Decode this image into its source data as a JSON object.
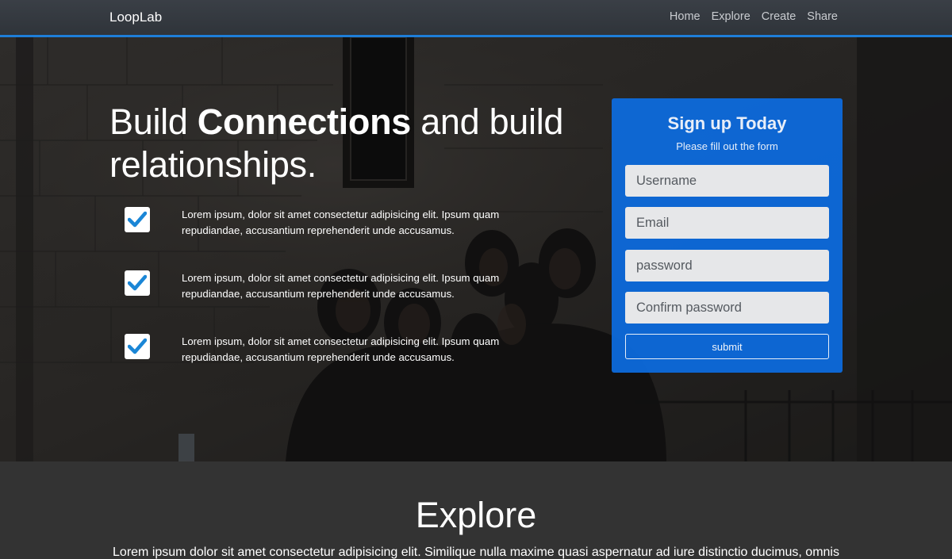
{
  "nav": {
    "brand": "LoopLab",
    "links": [
      "Home",
      "Explore",
      "Create",
      "Share"
    ]
  },
  "hero": {
    "headline_part1": "Build ",
    "headline_strong": "Connections",
    "headline_part2": " and build relationships.",
    "features": [
      "Lorem ipsum, dolor sit amet consectetur adipisicing elit. Ipsum quam repudiandae, accusantium reprehenderit unde accusamus.",
      "Lorem ipsum, dolor sit amet consectetur adipisicing elit. Ipsum quam repudiandae, accusantium reprehenderit unde accusamus.",
      "Lorem ipsum, dolor sit amet consectetur adipisicing elit. Ipsum quam repudiandae, accusantium reprehenderit unde accusamus."
    ]
  },
  "signup": {
    "title": "Sign up Today",
    "subtitle": "Please fill out the form",
    "username_placeholder": "Username",
    "email_placeholder": "Email",
    "password_placeholder": "password",
    "confirm_placeholder": "Confirm password",
    "submit_label": "submit"
  },
  "explore": {
    "title": "Explore",
    "text": "Lorem ipsum dolor sit amet consectetur adipisicing elit. Similique nulla maxime quasi aspernatur ad iure distinctio ducimus, omnis"
  },
  "colors": {
    "accent": "#1e7ed8",
    "card": "#0c6ce2",
    "check": "#1a86d6",
    "section_bg": "#333333"
  },
  "icons": {
    "checkbox": "check-square-icon"
  }
}
